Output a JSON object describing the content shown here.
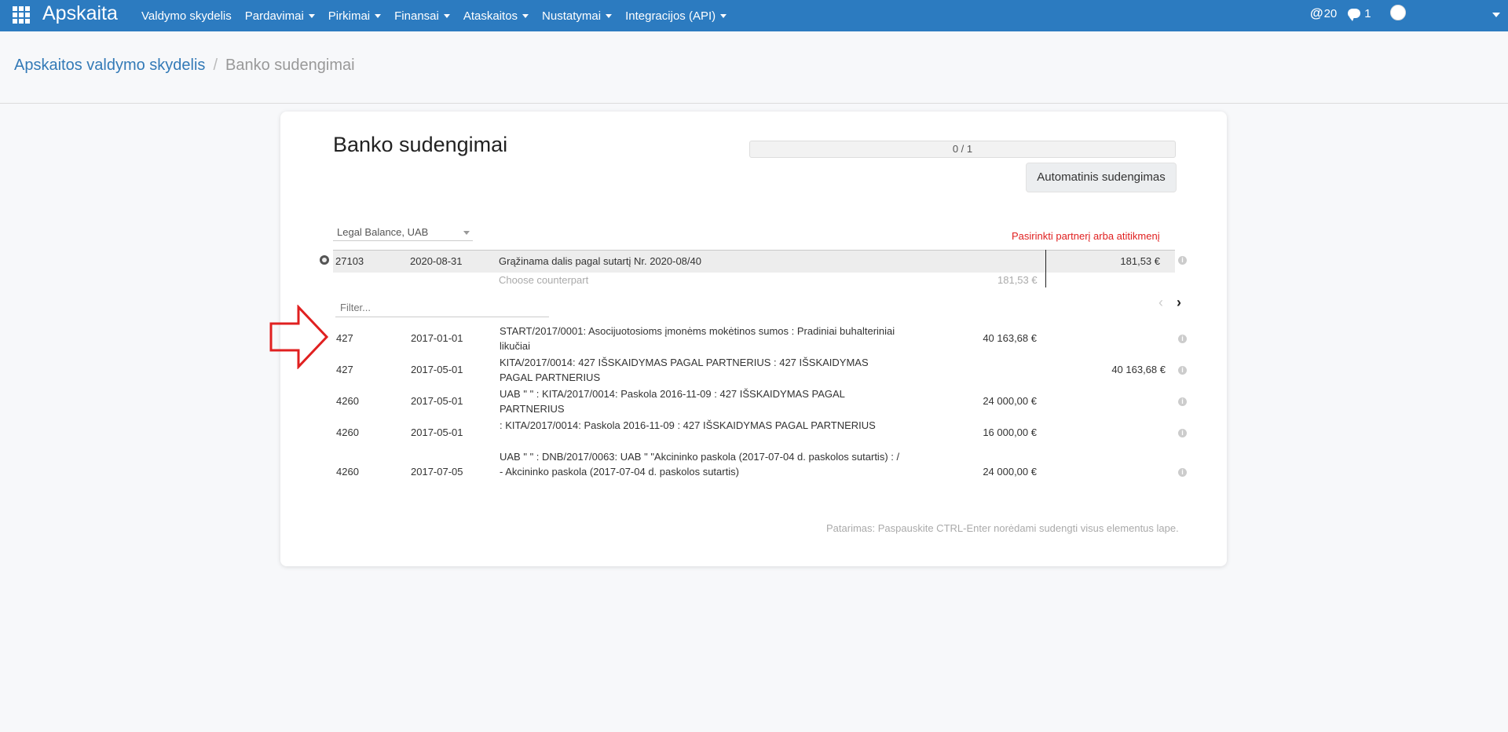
{
  "navbar": {
    "brand": "Apskaita",
    "menu": [
      {
        "label": "Valdymo skydelis",
        "dropdown": false
      },
      {
        "label": "Pardavimai",
        "dropdown": true
      },
      {
        "label": "Pirkimai",
        "dropdown": true
      },
      {
        "label": "Finansai",
        "dropdown": true
      },
      {
        "label": "Ataskaitos",
        "dropdown": true
      },
      {
        "label": "Nustatymai",
        "dropdown": true
      },
      {
        "label": "Integracijos (API)",
        "dropdown": true
      }
    ],
    "mentions_count": "20",
    "messages_count": "1"
  },
  "breadcrumb": {
    "parent": "Apskaitos valdymo skydelis",
    "separator": "/",
    "current": "Banko sudengimai"
  },
  "page": {
    "title": "Banko sudengimai",
    "progress": "0 / 1",
    "auto_button": "Automatinis sudengimas",
    "company": "Legal Balance, UAB",
    "select_hint": "Pasirinkti partnerį arba atitikmenį"
  },
  "statement_line": {
    "account": "27103",
    "date": "2020-08-31",
    "label": "Grąžinama dalis pagal sutartį Nr. 2020-08/40",
    "amount": "181,53 €",
    "counterpart_placeholder": "Choose counterpart",
    "counterpart_amount": "181,53 €"
  },
  "filter": {
    "placeholder": "Filter..."
  },
  "move_lines": [
    {
      "account": "427",
      "date": "2017-01-01",
      "label": "START/2017/0001: Asocijuotosioms įmonėms mokėtinos sumos : Pradiniai buhalteriniai likučiai",
      "debit": "40 163,68 €",
      "credit": ""
    },
    {
      "account": "427",
      "date": "2017-05-01",
      "label": "KITA/2017/0014: 427 IŠSKAIDYMAS PAGAL PARTNERIUS : 427 IŠSKAIDYMAS PAGAL PARTNERIUS",
      "debit": "",
      "credit": "40 163,68 €"
    },
    {
      "account": "4260",
      "date": "2017-05-01",
      "label": "UAB \"                         \" : KITA/2017/0014: Paskola 2016-11-09 : 427 IŠSKAIDYMAS PAGAL PARTNERIUS",
      "debit": "24 000,00 €",
      "credit": ""
    },
    {
      "account": "4260",
      "date": "2017-05-01",
      "label": "                               : KITA/2017/0014: Paskola 2016-11-09 : 427 IŠSKAIDYMAS PAGAL PARTNERIUS",
      "debit": "16 000,00 €",
      "credit": ""
    },
    {
      "account": "4260",
      "date": "2017-07-05",
      "label": "UAB \"                         \" : DNB/2017/0063: UAB \"                           \"Akcininko paskola (2017-07-04 d. paskolos sutartis) : / - Akcininko paskola (2017-07-04 d. paskolos sutartis)",
      "debit": "24 000,00 €",
      "credit": ""
    }
  ],
  "tip": "Patarimas: Paspauskite CTRL-Enter norėdami sudengti visus elementus lape.",
  "colors": {
    "navbar": "#2c7bc0",
    "link": "#337ab7",
    "hint": "#e02020",
    "arrow": "#e02020"
  }
}
